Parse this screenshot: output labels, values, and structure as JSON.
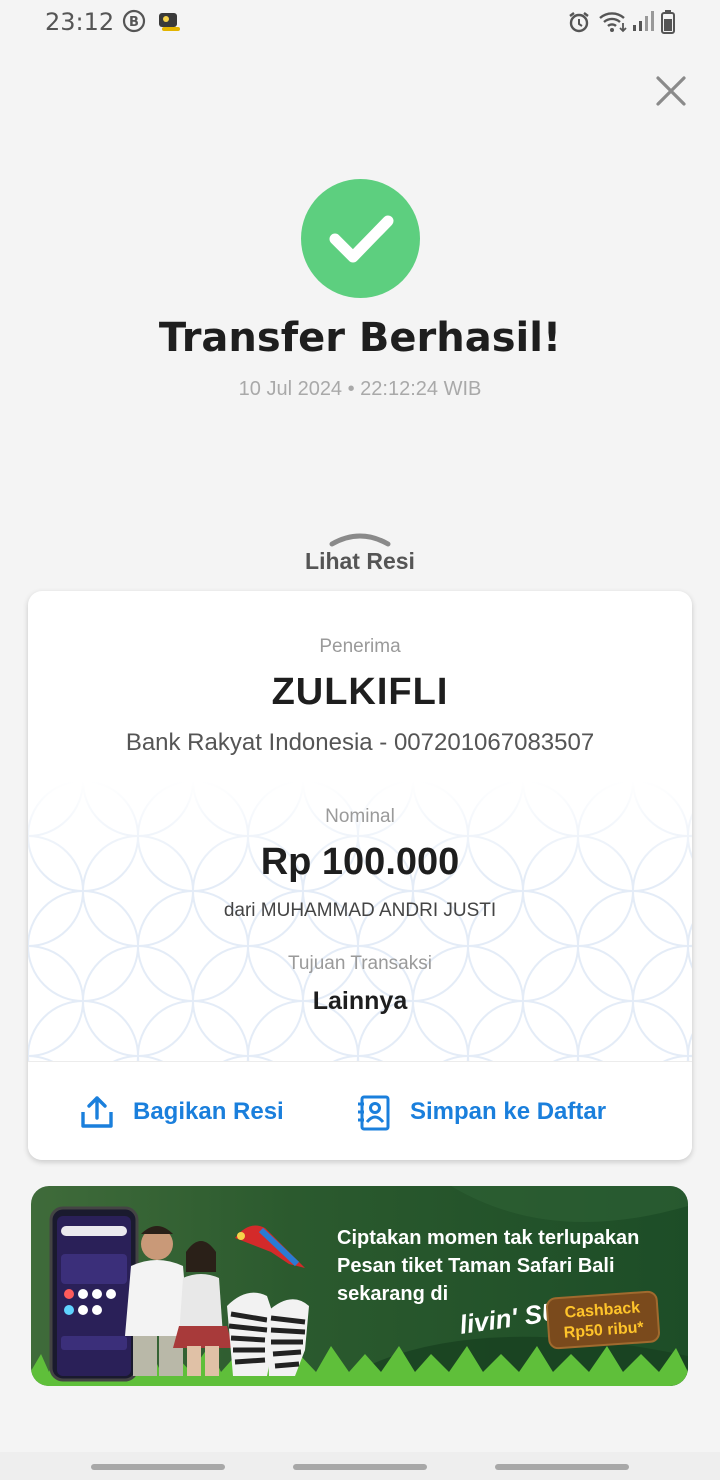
{
  "status_bar": {
    "time": "23:12",
    "left_icons": [
      "b-badge-icon",
      "app-notification-icon"
    ],
    "right_icons": [
      "alarm-icon",
      "wifi-icon",
      "signal-icon",
      "battery-icon"
    ]
  },
  "header": {
    "close_icon": "close-icon",
    "success_icon": "checkmark-icon",
    "title": "Transfer Berhasil!",
    "datetime": "10 Jul 2024 • 22:12:24 WIB"
  },
  "receipt_toggle": {
    "label": "Lihat Resi",
    "icon": "chevron-up-icon"
  },
  "receipt": {
    "recipient_label": "Penerima",
    "recipient_name": "ZULKIFLI",
    "recipient_bank": "Bank Rakyat Indonesia - 007201067083507",
    "amount_label": "Nominal",
    "amount": "Rp 100.000",
    "sender": "dari MUHAMMAD ANDRI JUSTI",
    "purpose_label": "Tujuan Transaksi",
    "purpose": "Lainnya"
  },
  "actions": {
    "share_label": "Bagikan Resi",
    "save_label": "Simpan ke Daftar"
  },
  "banner": {
    "line1": "Ciptakan momen tak terlupakan",
    "line2": "Pesan tiket Taman Safari Bali",
    "line3": "sekarang di",
    "brand": "livin' SUKHA",
    "cashback": "Cashback Rp50 ribu*"
  },
  "colors": {
    "success": "#5dcf7f",
    "link": "#1a7fdc",
    "banner_bg": "#1f5a2a"
  }
}
